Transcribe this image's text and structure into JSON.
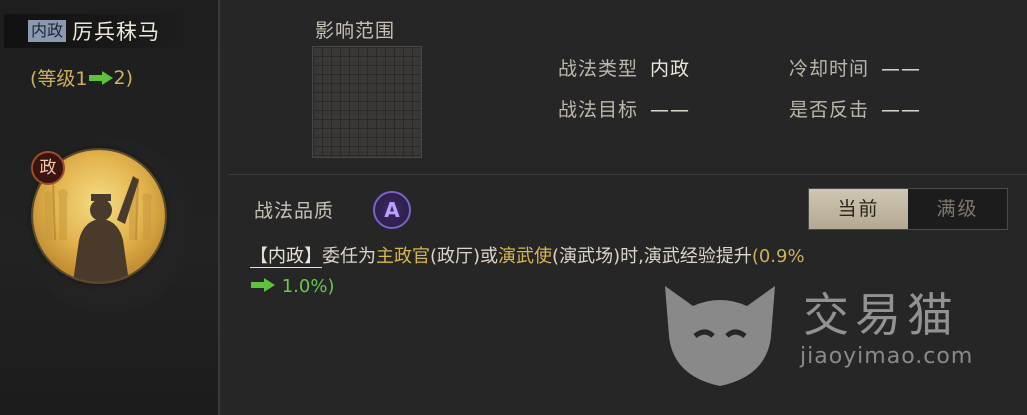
{
  "skill": {
    "type_tag": "内政",
    "name": "厉兵秣马",
    "level_prefix": "(等级1",
    "level_suffix": "2)",
    "attribute_badge": "政"
  },
  "range": {
    "label": "影响范围"
  },
  "info": {
    "type_label": "战法类型",
    "type_value": "内政",
    "target_label": "战法目标",
    "target_value": "——",
    "cooldown_label": "冷却时间",
    "cooldown_value": "——",
    "counter_label": "是否反击",
    "counter_value": "——"
  },
  "quality": {
    "label": "战法品质",
    "grade": "A"
  },
  "tabs": {
    "current": "当前",
    "max": "满级"
  },
  "description": {
    "tag": "【内政】",
    "t1": "委任为",
    "hl1": "主政官",
    "t2": "(政厅)或",
    "hl2": "演武使",
    "t3": "(演武场)时,演武经验提升",
    "old_value": "(0.9%",
    "new_value": "1.0%)"
  },
  "watermark": {
    "text": "交易猫",
    "url": "jiaoyimao.com"
  },
  "colors": {
    "accent_gold": "#cbb15f",
    "increase_green": "#5fc23b",
    "quality_purple": "#7d5fc8"
  },
  "icons": [
    "politics-badge-icon",
    "arrow-right-icon",
    "quality-a-icon",
    "watermark-cat-logo"
  ]
}
